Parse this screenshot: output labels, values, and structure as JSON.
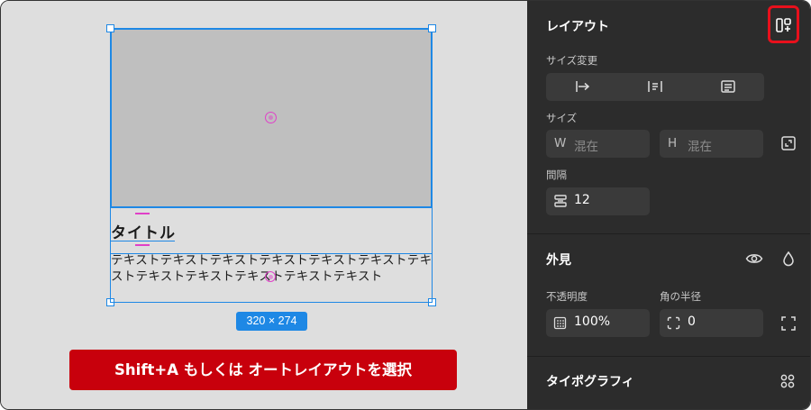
{
  "canvas": {
    "title_text": "タイトル",
    "body_text": "テキストテキストテキストテキストテキストテキストテキストテキストテキストテキストテキストテキスト",
    "size_badge": "320 × 274",
    "caption": "Shift+A もしくは オートレイアウトを選択"
  },
  "panel": {
    "layout": {
      "title": "レイアウト",
      "resize_label": "サイズ変更",
      "size_label": "サイズ",
      "width_prefix": "W",
      "width_value": "混在",
      "height_prefix": "H",
      "height_value": "混在",
      "gap_label": "間隔",
      "gap_value": "12"
    },
    "appearance": {
      "title": "外見",
      "opacity_label": "不透明度",
      "opacity_value": "100%",
      "radius_label": "角の半径",
      "radius_value": "0"
    },
    "typography": {
      "title": "タイポグラフィ"
    }
  },
  "colors": {
    "accent_blue": "#1e88e5",
    "highlight_red": "#e8101c",
    "caption_red": "#c8000c",
    "panel_bg": "#2c2c2c",
    "field_bg": "#3a3a3a"
  }
}
